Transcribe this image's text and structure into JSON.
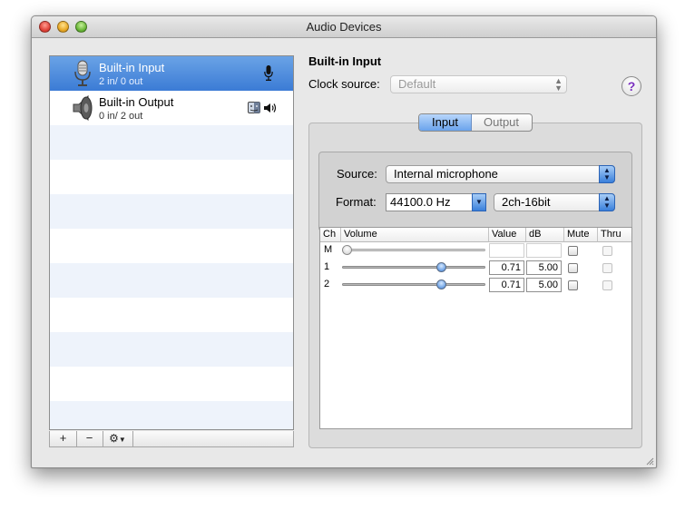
{
  "window": {
    "title": "Audio Devices"
  },
  "devices": [
    {
      "name": "Built-in Input",
      "io": "2 in/ 0 out",
      "selected": true
    },
    {
      "name": "Built-in Output",
      "io": "0 in/ 2 out",
      "selected": false
    }
  ],
  "list_toolbar": {
    "add": "+",
    "remove": "−",
    "gear": "⚙"
  },
  "detail": {
    "heading": "Built-in Input",
    "clock_source_label": "Clock source:",
    "clock_source_value": "Default",
    "help": "?",
    "tabs": [
      {
        "label": "Input",
        "active": true
      },
      {
        "label": "Output",
        "active": false
      }
    ],
    "source_label": "Source:",
    "source_value": "Internal microphone",
    "format_label": "Format:",
    "format_rate": "44100.0 Hz",
    "format_bits": "2ch-16bit",
    "table": {
      "headers": [
        "Ch",
        "Volume",
        "Value",
        "dB",
        "Mute",
        "Thru"
      ],
      "rows": [
        {
          "ch": "M",
          "volume": 0,
          "value": "",
          "db": "",
          "enabled": false
        },
        {
          "ch": "1",
          "volume": 0.71,
          "value": "0.71",
          "db": "5.00",
          "enabled": true
        },
        {
          "ch": "2",
          "volume": 0.71,
          "value": "0.71",
          "db": "5.00",
          "enabled": true
        }
      ]
    }
  },
  "colors": {
    "selection": "#3b7bd5",
    "stripe": "#eef3fb",
    "help_glyph": "#7a2fbf"
  }
}
